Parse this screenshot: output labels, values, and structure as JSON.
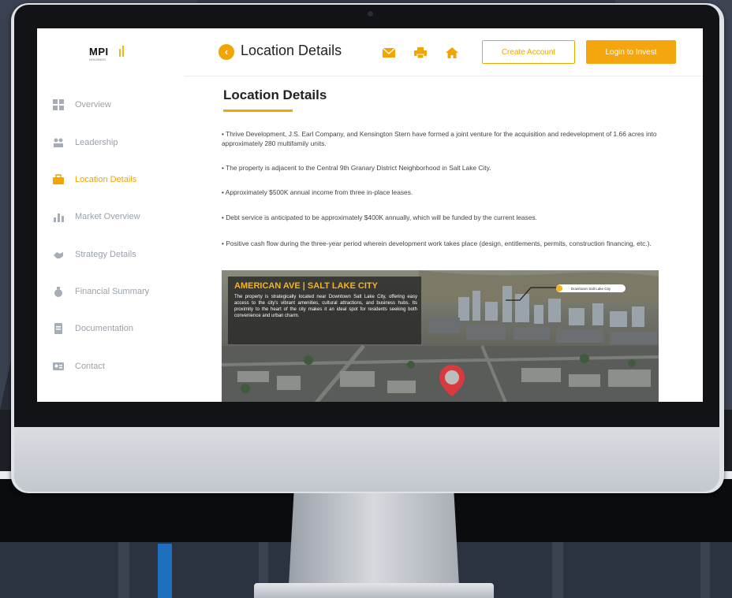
{
  "brand": {
    "logo_text": "MPI",
    "logo_sub": "HOLDINGS",
    "accent": "#f0a500"
  },
  "sidebar": {
    "items": [
      {
        "label": "Overview",
        "icon": "grid-icon"
      },
      {
        "label": "Leadership",
        "icon": "users-icon"
      },
      {
        "label": "Location Details",
        "icon": "briefcase-icon",
        "active": true
      },
      {
        "label": "Market Overview",
        "icon": "bar-chart-icon"
      },
      {
        "label": "Strategy Details",
        "icon": "handshake-icon"
      },
      {
        "label": "Financial Summary",
        "icon": "money-bag-icon"
      },
      {
        "label": "Documentation",
        "icon": "document-icon"
      },
      {
        "label": "Contact",
        "icon": "contact-card-icon"
      }
    ]
  },
  "header": {
    "title": "Location Details",
    "icons": [
      "mail-icon",
      "print-icon",
      "home-icon"
    ],
    "create_account": "Create Account",
    "login": "Login to Invest"
  },
  "main": {
    "section_title": "Location Details",
    "bullets": [
      "• Thrive Development, J.S. Earl Company, and Kensington Stern have formed a joint venture for the acquisition and redevelopment of 1.66 acres into approximately 280 multifamily units.",
      "• The property is adjacent to the Central 9th Granary District Neighborhood in Salt Lake City.",
      "• Approximately $500K annual income from three in-place leases.",
      "• Debt service is anticipated to be approximately $400K annually, which will be funded by the current leases.",
      "• Positive cash flow during the three-year period wherein development work takes place (design, entitlements, permits, construction financing, etc.)."
    ],
    "photo": {
      "title": "AMERICAN AVE | SALT LAKE CITY",
      "text": "The property is strategically located near Downtown Salt Lake City, offering easy access to the city's vibrant amenities, cultural attractions, and business hubs. Its proximity to the heart of the city makes it an ideal spot for residents seeking both convenience and urban charm.",
      "tag": "Downtown Salt Lake City"
    }
  }
}
